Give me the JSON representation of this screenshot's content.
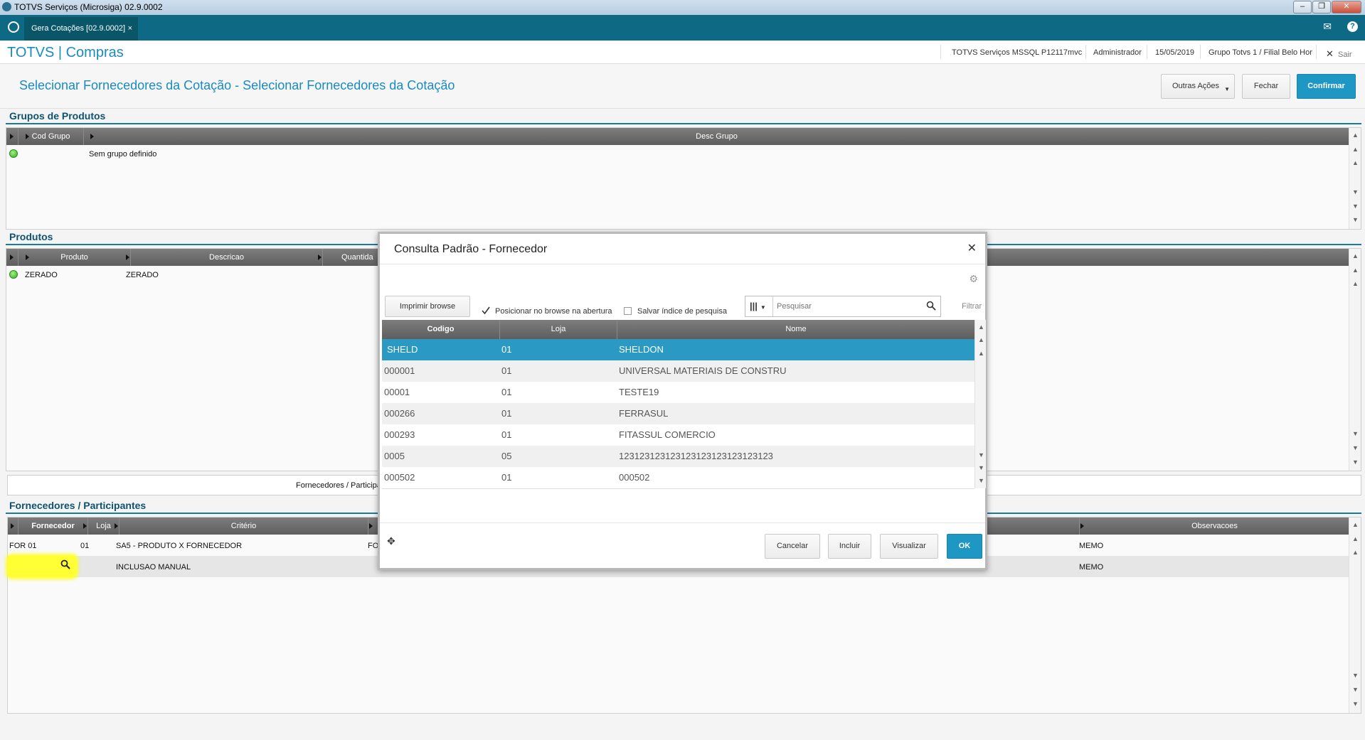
{
  "window": {
    "title": "TOTVS Serviços (Microsiga) 02.9.0002"
  },
  "tabbar": {
    "tab_label": "Gera Cotações [02.9.0002]",
    "tab_close": "×"
  },
  "header": {
    "brand": "TOTVS | Compras",
    "environment": "TOTVS Serviços MSSQL P12117mvc",
    "user": "Administrador",
    "date": "15/05/2019",
    "branch": "Grupo Totvs 1 / Filial Belo Hor",
    "exit_label": "Sair"
  },
  "page": {
    "title": "Selecionar Fornecedores da Cotação - Selecionar Fornecedores da Cotação",
    "actions": {
      "other": "Outras Ações",
      "close": "Fechar",
      "confirm": "Confirmar"
    }
  },
  "groups": {
    "title": "Grupos de Produtos",
    "columns": [
      "Cod Grupo",
      "Desc Grupo"
    ],
    "rows": [
      {
        "desc": "Sem grupo definido"
      }
    ]
  },
  "products": {
    "title": "Produtos",
    "columns": [
      "Produto",
      "Descricao",
      "Quantida"
    ],
    "rows": [
      {
        "produto": "ZERADO",
        "descricao": "ZERADO"
      }
    ]
  },
  "tabstrip": {
    "label": "Fornecedores / Participa"
  },
  "suppliers": {
    "title": "Fornecedores / Participantes",
    "columns": [
      "Fornecedor",
      "Loja",
      "Critério",
      "Observacoes"
    ],
    "rows": [
      {
        "fornecedor": "FOR 01",
        "loja": "01",
        "criterio": "SA5 - PRODUTO X FORNECEDOR",
        "criterio2": "FO",
        "obs": "MEMO"
      },
      {
        "fornecedor": "",
        "loja": "",
        "criterio": "INCLUSAO MANUAL",
        "criterio2": "",
        "obs": "MEMO"
      }
    ]
  },
  "dialog": {
    "title": "Consulta Padrão - Fornecedor",
    "print_button": "Imprimir browse",
    "position_label": "Posicionar no browse na abertura",
    "save_index_label": "Salvar índice de pesquisa",
    "search_placeholder": "Pesquisar",
    "filter_label": "Filtrar",
    "columns": [
      "Codigo",
      "Loja",
      "Nome"
    ],
    "rows": [
      {
        "codigo": "SHELD",
        "loja": "01",
        "nome": "SHELDON"
      },
      {
        "codigo": "000001",
        "loja": "01",
        "nome": "UNIVERSAL MATERIAIS DE CONSTRU"
      },
      {
        "codigo": "00001",
        "loja": "01",
        "nome": "TESTE19"
      },
      {
        "codigo": "000266",
        "loja": "01",
        "nome": "FERRASUL"
      },
      {
        "codigo": "000293",
        "loja": "01",
        "nome": "FITASSUL COMERCIO"
      },
      {
        "codigo": "0005",
        "loja": "05",
        "nome": "123123123123123123123123123123"
      },
      {
        "codigo": "000502",
        "loja": "01",
        "nome": "000502"
      }
    ],
    "buttons": {
      "cancel": "Cancelar",
      "include": "Incluir",
      "view": "Visualizar",
      "ok": "OK"
    }
  },
  "colors": {
    "accent": "#1a8bbf",
    "tabbar": "#0e6a84",
    "selected_row": "#2a9ac4",
    "highlight": "#ffff33"
  }
}
